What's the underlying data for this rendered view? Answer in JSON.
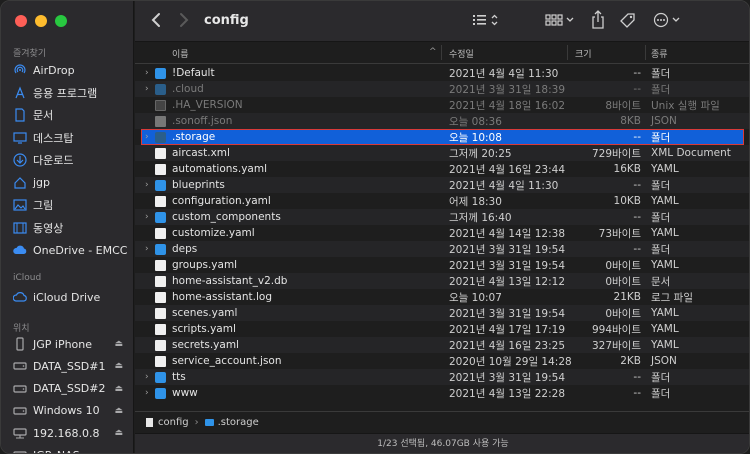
{
  "window": {
    "title": "config"
  },
  "sidebar": {
    "favorites_label": "즐겨찾기",
    "favorites": [
      {
        "label": "AirDrop",
        "icon": "airdrop-icon"
      },
      {
        "label": "응용 프로그램",
        "icon": "applications-icon"
      },
      {
        "label": "문서",
        "icon": "document-icon"
      },
      {
        "label": "데스크탑",
        "icon": "desktop-icon"
      },
      {
        "label": "다운로드",
        "icon": "downloads-icon"
      },
      {
        "label": "jgp",
        "icon": "home-icon"
      },
      {
        "label": "그림",
        "icon": "pictures-icon"
      },
      {
        "label": "동영상",
        "icon": "movies-icon"
      },
      {
        "label": "OneDrive - EMCC",
        "icon": "cloud-icon"
      }
    ],
    "icloud_label": "iCloud",
    "icloud": [
      {
        "label": "iCloud Drive",
        "icon": "icloud-icon"
      }
    ],
    "locations_label": "위치",
    "locations": [
      {
        "label": "JGP iPhone",
        "icon": "iphone-icon",
        "eject": true
      },
      {
        "label": "DATA_SSD#1",
        "icon": "drive-icon",
        "eject": true
      },
      {
        "label": "DATA_SSD#2",
        "icon": "drive-icon",
        "eject": true
      },
      {
        "label": "Windows 10",
        "icon": "drive-icon",
        "eject": true
      },
      {
        "label": "192.168.0.8",
        "icon": "network-drive-icon",
        "eject": true
      },
      {
        "label": "JGP_NAS",
        "icon": "network-drive-icon",
        "eject": false
      }
    ]
  },
  "columns": {
    "name": "이름",
    "date": "수정일",
    "size": "크기",
    "kind": "종류"
  },
  "files": [
    {
      "name": "!Default",
      "date": "2021년 4월 4일 11:30",
      "size": "--",
      "kind": "폴더",
      "type": "folder",
      "dim": false
    },
    {
      "name": ".cloud",
      "date": "2021년 3월 31일 18:39",
      "size": "--",
      "kind": "폴더",
      "type": "folder",
      "dim": true
    },
    {
      "name": ".HA_VERSION",
      "date": "2021년 4월 18일 16:02",
      "size": "8바이트",
      "kind": "Unix 실행 파일",
      "type": "exec",
      "dim": true
    },
    {
      "name": ".sonoff.json",
      "date": "오늘 08:36",
      "size": "8KB",
      "kind": "JSON",
      "type": "doc",
      "dim": true
    },
    {
      "name": ".storage",
      "date": "오늘 10:08",
      "size": "--",
      "kind": "폴더",
      "type": "folder",
      "dim": true,
      "selected": true
    },
    {
      "name": "aircast.xml",
      "date": "그저께 20:25",
      "size": "729바이트",
      "kind": "XML Document",
      "type": "doc",
      "dim": false
    },
    {
      "name": "automations.yaml",
      "date": "2021년 4월 16일 23:44",
      "size": "16KB",
      "kind": "YAML",
      "type": "doc",
      "dim": false
    },
    {
      "name": "blueprints",
      "date": "2021년 4월 4일 11:30",
      "size": "--",
      "kind": "폴더",
      "type": "folder",
      "dim": false
    },
    {
      "name": "configuration.yaml",
      "date": "어제 18:30",
      "size": "10KB",
      "kind": "YAML",
      "type": "doc",
      "dim": false
    },
    {
      "name": "custom_components",
      "date": "그저께 16:40",
      "size": "--",
      "kind": "폴더",
      "type": "folder",
      "dim": false
    },
    {
      "name": "customize.yaml",
      "date": "2021년 4월 14일 12:38",
      "size": "73바이트",
      "kind": "YAML",
      "type": "doc",
      "dim": false
    },
    {
      "name": "deps",
      "date": "2021년 3월 31일 19:54",
      "size": "--",
      "kind": "폴더",
      "type": "folder",
      "dim": false
    },
    {
      "name": "groups.yaml",
      "date": "2021년 3월 31일 19:54",
      "size": "0바이트",
      "kind": "YAML",
      "type": "doc",
      "dim": false
    },
    {
      "name": "home-assistant_v2.db",
      "date": "2021년 4월 13일 12:12",
      "size": "0바이트",
      "kind": "문서",
      "type": "doc",
      "dim": false
    },
    {
      "name": "home-assistant.log",
      "date": "오늘 10:07",
      "size": "21KB",
      "kind": "로그 파일",
      "type": "doc",
      "dim": false
    },
    {
      "name": "scenes.yaml",
      "date": "2021년 3월 31일 19:54",
      "size": "0바이트",
      "kind": "YAML",
      "type": "doc",
      "dim": false
    },
    {
      "name": "scripts.yaml",
      "date": "2021년 4월 17일 17:19",
      "size": "994바이트",
      "kind": "YAML",
      "type": "doc",
      "dim": false
    },
    {
      "name": "secrets.yaml",
      "date": "2021년 4월 16일 23:25",
      "size": "327바이트",
      "kind": "YAML",
      "type": "doc",
      "dim": false
    },
    {
      "name": "service_account.json",
      "date": "2020년 10월 29일 14:28",
      "size": "2KB",
      "kind": "JSON",
      "type": "doc",
      "dim": false
    },
    {
      "name": "tts",
      "date": "2021년 3월 31일 19:54",
      "size": "--",
      "kind": "폴더",
      "type": "folder",
      "dim": false
    },
    {
      "name": "www",
      "date": "2021년 4월 13일 22:28",
      "size": "--",
      "kind": "폴더",
      "type": "folder",
      "dim": false
    }
  ],
  "pathbar": {
    "root": "config",
    "current": ".storage"
  },
  "status": "1/23 선택됨, 46.07GB 사용 가능"
}
